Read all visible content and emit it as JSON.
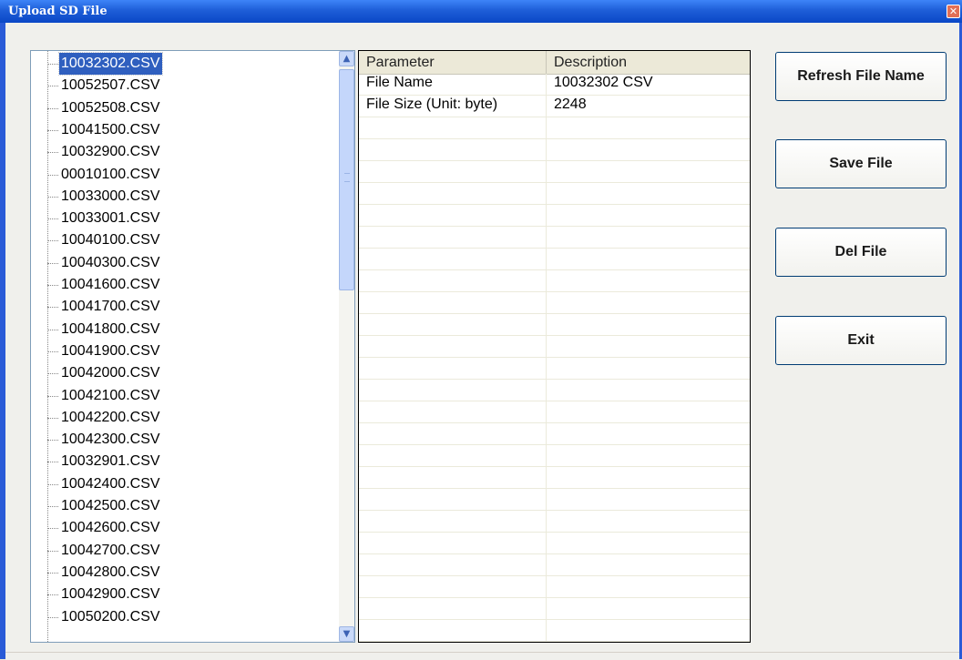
{
  "window": {
    "title": "Upload SD File",
    "close_glyph": "✕"
  },
  "file_tree": {
    "selected_index": 0,
    "items": [
      "10032302.CSV",
      "10052507.CSV",
      "10052508.CSV",
      "10041500.CSV",
      "10032900.CSV",
      "00010100.CSV",
      "10033000.CSV",
      "10033001.CSV",
      "10040100.CSV",
      "10040300.CSV",
      "10041600.CSV",
      "10041700.CSV",
      "10041800.CSV",
      "10041900.CSV",
      "10042000.CSV",
      "10042100.CSV",
      "10042200.CSV",
      "10042300.CSV",
      "10032901.CSV",
      "10042400.CSV",
      "10042500.CSV",
      "10042600.CSV",
      "10042700.CSV",
      "10042800.CSV",
      "10042900.CSV",
      "10050200.CSV"
    ]
  },
  "grid": {
    "columns": [
      "Parameter",
      "Description"
    ],
    "rows": [
      [
        "File Name",
        "10032302 CSV"
      ],
      [
        "File Size (Unit: byte)",
        "2248"
      ]
    ],
    "empty_rows": 24
  },
  "buttons": {
    "refresh": "Refresh File Name",
    "save": "Save File",
    "del": "Del File",
    "exit": "Exit"
  },
  "icons": {
    "scroll_up": "chevron-up-icon",
    "scroll_down": "chevron-down-icon",
    "close": "close-icon"
  }
}
